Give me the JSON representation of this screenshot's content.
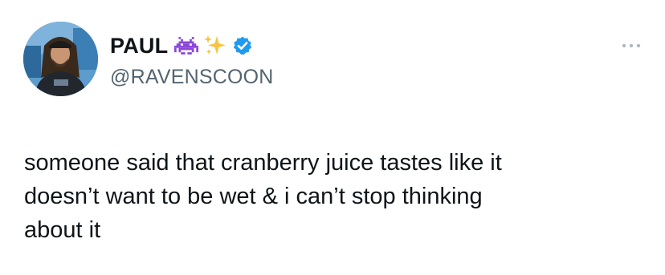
{
  "author": {
    "display_name": "PAUL",
    "handle": "@RAVENSCOON",
    "avatar_alt": "profile photo",
    "name_emojis": [
      "space-invader-icon",
      "sparkles-icon"
    ],
    "verified": true
  },
  "post": {
    "text": "someone said that cranberry juice tastes like it\ndoesn’t want to be wet & i can’t stop thinking\nabout it"
  },
  "colors": {
    "verified_badge": "#1d9bf0",
    "invader": "#8b48d8",
    "sparkle": "#f5c542",
    "handle": "#536471",
    "more_dots": "#b0b8c0"
  },
  "icons": {
    "more": "more-horizontal-icon",
    "verified": "verified-badge-icon"
  }
}
